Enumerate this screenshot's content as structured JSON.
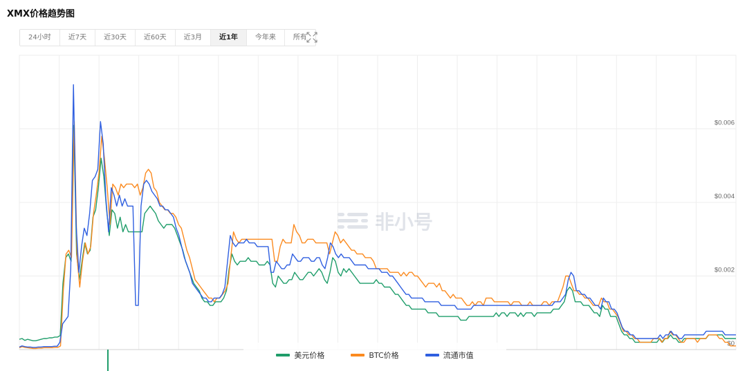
{
  "page": {
    "title": "XMX价格趋势图"
  },
  "range_tabs": [
    {
      "label": "24小时",
      "active": false
    },
    {
      "label": "近7天",
      "active": false
    },
    {
      "label": "近30天",
      "active": false
    },
    {
      "label": "近60天",
      "active": false
    },
    {
      "label": "近3月",
      "active": false
    },
    {
      "label": "近1年",
      "active": true
    },
    {
      "label": "今年来",
      "active": false
    },
    {
      "label": "所有",
      "active": false
    }
  ],
  "icons": {
    "expand": "expand-arrows-icon",
    "watermark": "feixiaohao-logo-icon"
  },
  "watermark": {
    "text": "非小号"
  },
  "colors": {
    "usd": "#1f9d6a",
    "btc": "#fb8a1f",
    "cap": "#2f5fe0",
    "grid": "#eeeeee"
  },
  "chart_data": {
    "type": "line",
    "title": "XMX价格趋势图",
    "xlabel": "",
    "ylabel": "",
    "ylim": [
      0,
      0.008
    ],
    "yticks": [
      {
        "value": 0,
        "label": "$0"
      },
      {
        "value": 0.002,
        "label": "$0.002"
      },
      {
        "value": 0.004,
        "label": "$0.004"
      },
      {
        "value": 0.006,
        "label": "$0.006"
      }
    ],
    "grid": true,
    "legend_position": "bottom-center",
    "series": [
      {
        "name": "美元价格",
        "key": "usd",
        "values": [
          0.00028,
          0.0003,
          0.00025,
          0.00028,
          0.00026,
          0.00024,
          0.00024,
          0.00026,
          0.00028,
          0.0003,
          0.0003,
          0.00032,
          0.00032,
          0.00034,
          0.00034,
          0.00038,
          0.0018,
          0.0025,
          0.0026,
          0.0024,
          0.0061,
          0.0026,
          0.0019,
          0.0024,
          0.0029,
          0.0026,
          0.0027,
          0.0036,
          0.0038,
          0.0044,
          0.0052,
          0.0047,
          0.0038,
          0.0031,
          0.0038,
          0.0037,
          0.0033,
          0.0036,
          0.0032,
          0.0034,
          0.0032,
          0.0032,
          0.0032,
          0.0032,
          0.0032,
          0.0032,
          0.0037,
          0.0038,
          0.0039,
          0.0038,
          0.0037,
          0.0035,
          0.0034,
          0.0033,
          0.0034,
          0.0034,
          0.0034,
          0.0033,
          0.0031,
          0.0029,
          0.0027,
          0.0024,
          0.0022,
          0.002,
          0.0018,
          0.0017,
          0.0016,
          0.0014,
          0.0013,
          0.0013,
          0.0012,
          0.0012,
          0.0013,
          0.0013,
          0.0013,
          0.0014,
          0.0016,
          0.0022,
          0.0026,
          0.0024,
          0.0023,
          0.0024,
          0.0024,
          0.0024,
          0.0025,
          0.0024,
          0.0024,
          0.0024,
          0.0023,
          0.0023,
          0.0023,
          0.0024,
          0.0023,
          0.0018,
          0.0017,
          0.002,
          0.0019,
          0.0018,
          0.0018,
          0.0019,
          0.0019,
          0.0021,
          0.002,
          0.0019,
          0.0019,
          0.002,
          0.0021,
          0.0021,
          0.002,
          0.0021,
          0.0022,
          0.0021,
          0.0019,
          0.0018,
          0.0021,
          0.0025,
          0.0024,
          0.0021,
          0.002,
          0.0022,
          0.0021,
          0.0022,
          0.0021,
          0.002,
          0.0019,
          0.0018,
          0.0018,
          0.0018,
          0.0018,
          0.0018,
          0.0018,
          0.0019,
          0.0018,
          0.0018,
          0.0017,
          0.0017,
          0.0017,
          0.0016,
          0.0015,
          0.0015,
          0.0014,
          0.0013,
          0.0012,
          0.0012,
          0.0011,
          0.0011,
          0.0011,
          0.0011,
          0.0011,
          0.0011,
          0.001,
          0.001,
          0.001,
          0.001,
          0.0009,
          0.0009,
          0.0009,
          0.0009,
          0.0009,
          0.0009,
          0.0009,
          0.0009,
          0.0008,
          0.0008,
          0.0008,
          0.0009,
          0.0009,
          0.0009,
          0.0009,
          0.0009,
          0.0009,
          0.0009,
          0.0009,
          0.0009,
          0.0009,
          0.001,
          0.0009,
          0.001,
          0.001,
          0.0009,
          0.001,
          0.001,
          0.001,
          0.0009,
          0.001,
          0.0009,
          0.001,
          0.001,
          0.001,
          0.0009,
          0.001,
          0.001,
          0.001,
          0.001,
          0.001,
          0.001,
          0.0011,
          0.0011,
          0.0011,
          0.0012,
          0.0013,
          0.0016,
          0.0017,
          0.0016,
          0.0013,
          0.0013,
          0.0013,
          0.0012,
          0.0012,
          0.0012,
          0.0011,
          0.001,
          0.001,
          0.0009,
          0.0012,
          0.0011,
          0.0011,
          0.0009,
          0.0009,
          0.0009,
          0.0007,
          0.0005,
          0.0004,
          0.0004,
          0.0003,
          0.0003,
          0.0002,
          0.0002,
          0.0002,
          0.0002,
          0.0002,
          0.0002,
          0.0002,
          0.0002,
          0.0002,
          0.0003,
          0.0002,
          0.0003,
          0.0003,
          0.0004,
          0.0003,
          0.0003,
          0.0002,
          0.0002,
          0.0003,
          0.0003,
          0.0003,
          0.0003,
          0.0003,
          0.0003,
          0.0003,
          0.0003,
          0.0003,
          0.0004,
          0.0004,
          0.0004,
          0.0004,
          0.0004,
          0.0004,
          0.0003,
          0.0003,
          0.0003,
          0.0003,
          0.0003
        ]
      },
      {
        "name": "BTC价格",
        "key": "btc",
        "values": [
          5e-05,
          8e-05,
          6e-05,
          5e-05,
          4e-05,
          3e-05,
          3e-05,
          4e-05,
          4e-05,
          5e-05,
          5e-05,
          5e-05,
          5e-05,
          6e-05,
          6e-05,
          0.0001,
          0.0016,
          0.0026,
          0.0027,
          0.0025,
          0.0062,
          0.0025,
          0.0017,
          0.0024,
          0.0029,
          0.0026,
          0.0028,
          0.0037,
          0.0042,
          0.0048,
          0.0058,
          0.0052,
          0.0044,
          0.0034,
          0.0045,
          0.0044,
          0.0042,
          0.0045,
          0.0044,
          0.0045,
          0.0045,
          0.0045,
          0.0044,
          0.0045,
          0.0042,
          0.0044,
          0.0048,
          0.0049,
          0.0048,
          0.0044,
          0.0043,
          0.004,
          0.0039,
          0.0038,
          0.0038,
          0.0037,
          0.0037,
          0.0036,
          0.0034,
          0.0033,
          0.003,
          0.0027,
          0.0025,
          0.0022,
          0.0019,
          0.0018,
          0.0017,
          0.0016,
          0.0015,
          0.0014,
          0.0014,
          0.0013,
          0.0014,
          0.0014,
          0.0015,
          0.0016,
          0.0018,
          0.0025,
          0.0032,
          0.003,
          0.0029,
          0.003,
          0.003,
          0.003,
          0.003,
          0.003,
          0.003,
          0.003,
          0.003,
          0.003,
          0.003,
          0.003,
          0.003,
          0.0024,
          0.0024,
          0.0028,
          0.003,
          0.0029,
          0.0029,
          0.0029,
          0.0034,
          0.0032,
          0.0031,
          0.0029,
          0.0029,
          0.003,
          0.003,
          0.003,
          0.0029,
          0.0029,
          0.0029,
          0.0029,
          0.0029,
          0.0026,
          0.0029,
          0.0032,
          0.0031,
          0.0029,
          0.003,
          0.0029,
          0.0028,
          0.0027,
          0.0027,
          0.0026,
          0.0026,
          0.0026,
          0.0025,
          0.0025,
          0.0025,
          0.0024,
          0.0022,
          0.0022,
          0.0022,
          0.0022,
          0.0022,
          0.0021,
          0.0021,
          0.0021,
          0.0021,
          0.002,
          0.0021,
          0.002,
          0.0021,
          0.0021,
          0.002,
          0.002,
          0.0019,
          0.0018,
          0.0017,
          0.0018,
          0.0018,
          0.0018,
          0.0017,
          0.0018,
          0.0016,
          0.0016,
          0.0015,
          0.0014,
          0.0015,
          0.0014,
          0.0014,
          0.0014,
          0.0013,
          0.0012,
          0.0012,
          0.0013,
          0.0012,
          0.0013,
          0.0013,
          0.0012,
          0.0014,
          0.0014,
          0.0014,
          0.0013,
          0.0013,
          0.0013,
          0.0013,
          0.0013,
          0.0013,
          0.0012,
          0.0013,
          0.0013,
          0.0013,
          0.0012,
          0.0012,
          0.0012,
          0.0013,
          0.0012,
          0.0012,
          0.0012,
          0.0012,
          0.0013,
          0.0013,
          0.0012,
          0.0013,
          0.0013,
          0.0013,
          0.0015,
          0.0017,
          0.002,
          0.002,
          0.0018,
          0.0016,
          0.0016,
          0.0015,
          0.0015,
          0.0014,
          0.0014,
          0.0013,
          0.0012,
          0.0012,
          0.0012,
          0.0014,
          0.0013,
          0.0013,
          0.0011,
          0.0011,
          0.001,
          0.0009,
          0.0007,
          0.0005,
          0.0005,
          0.0004,
          0.0004,
          0.0003,
          0.0003,
          0.0002,
          0.0002,
          0.0002,
          0.0002,
          0.0002,
          0.0003,
          0.0003,
          0.0003,
          0.0002,
          0.0003,
          0.0003,
          0.0005,
          0.0004,
          0.0004,
          0.0003,
          0.0002,
          0.0002,
          0.0003,
          0.0003,
          0.0003,
          0.0003,
          0.0002,
          0.0003,
          0.0003,
          0.0003,
          0.0004,
          0.0004,
          0.0004,
          0.0004,
          0.0003,
          0.0003,
          0.0002,
          0.0002,
          0.0001,
          0.0001,
          0.0001
        ]
      },
      {
        "name": "流通市值",
        "key": "cap",
        "values": [
          7e-05,
          0.0001,
          8e-05,
          7e-05,
          7e-05,
          6e-05,
          6e-05,
          7e-05,
          7e-05,
          8e-05,
          8e-05,
          8e-05,
          8e-05,
          9e-05,
          9e-05,
          0.0002,
          0.0007,
          0.0008,
          0.0009,
          0.0022,
          0.0072,
          0.0034,
          0.0021,
          0.0028,
          0.0033,
          0.0031,
          0.0037,
          0.0046,
          0.0047,
          0.0049,
          0.0062,
          0.0056,
          0.0041,
          0.0032,
          0.0044,
          0.0042,
          0.0039,
          0.0042,
          0.0039,
          0.0041,
          0.0039,
          0.0039,
          0.0039,
          0.0012,
          0.0012,
          0.0039,
          0.0045,
          0.0046,
          0.0045,
          0.0043,
          0.0042,
          0.0041,
          0.0039,
          0.0039,
          0.0038,
          0.0038,
          0.0037,
          0.0036,
          0.0033,
          0.0031,
          0.0028,
          0.0025,
          0.0023,
          0.0021,
          0.0018,
          0.0017,
          0.0016,
          0.0015,
          0.0014,
          0.0014,
          0.0013,
          0.0013,
          0.0014,
          0.0014,
          0.0014,
          0.0015,
          0.0017,
          0.0024,
          0.0031,
          0.0029,
          0.0028,
          0.0029,
          0.0029,
          0.0029,
          0.003,
          0.0029,
          0.0029,
          0.0029,
          0.0028,
          0.0028,
          0.0028,
          0.0028,
          0.0028,
          0.0021,
          0.0021,
          0.0024,
          0.0023,
          0.0022,
          0.0022,
          0.0023,
          0.0023,
          0.0026,
          0.0025,
          0.0024,
          0.0024,
          0.0025,
          0.0025,
          0.0025,
          0.0024,
          0.0024,
          0.0025,
          0.0025,
          0.0023,
          0.0022,
          0.0025,
          0.0029,
          0.0028,
          0.0026,
          0.0025,
          0.0026,
          0.0025,
          0.0025,
          0.0025,
          0.0024,
          0.0023,
          0.0023,
          0.0023,
          0.0023,
          0.0023,
          0.0022,
          0.0022,
          0.0022,
          0.0022,
          0.0022,
          0.0021,
          0.0021,
          0.0021,
          0.002,
          0.002,
          0.0019,
          0.0018,
          0.0017,
          0.0016,
          0.0015,
          0.0015,
          0.0014,
          0.0014,
          0.0014,
          0.0014,
          0.0014,
          0.0013,
          0.0013,
          0.0013,
          0.0013,
          0.0013,
          0.0013,
          0.0012,
          0.0012,
          0.0012,
          0.0012,
          0.0012,
          0.0012,
          0.0011,
          0.0011,
          0.0011,
          0.0011,
          0.0011,
          0.0011,
          0.0012,
          0.0012,
          0.0012,
          0.0012,
          0.0012,
          0.0012,
          0.0012,
          0.0012,
          0.0012,
          0.0012,
          0.0012,
          0.0012,
          0.0012,
          0.0012,
          0.0012,
          0.0012,
          0.0012,
          0.0012,
          0.0012,
          0.0012,
          0.0012,
          0.0012,
          0.0012,
          0.0012,
          0.0012,
          0.0012,
          0.0012,
          0.0012,
          0.0012,
          0.0012,
          0.0013,
          0.0013,
          0.0013,
          0.0014,
          0.0015,
          0.0019,
          0.0021,
          0.002,
          0.0016,
          0.0016,
          0.0015,
          0.0015,
          0.0014,
          0.0014,
          0.0013,
          0.0012,
          0.0012,
          0.0011,
          0.0014,
          0.0013,
          0.0013,
          0.0011,
          0.0011,
          0.001,
          0.0008,
          0.0006,
          0.0005,
          0.0005,
          0.0004,
          0.0004,
          0.0003,
          0.0003,
          0.0003,
          0.0003,
          0.0003,
          0.0003,
          0.0003,
          0.0003,
          0.0003,
          0.0004,
          0.0003,
          0.0004,
          0.0004,
          0.0005,
          0.0004,
          0.0004,
          0.0003,
          0.0003,
          0.0004,
          0.0004,
          0.0004,
          0.0004,
          0.0004,
          0.0004,
          0.0004,
          0.0004,
          0.0005,
          0.0005,
          0.0005,
          0.0005,
          0.0005,
          0.0005,
          0.0005,
          0.0004,
          0.0004,
          0.0004,
          0.0004,
          0.0004
        ]
      }
    ]
  }
}
